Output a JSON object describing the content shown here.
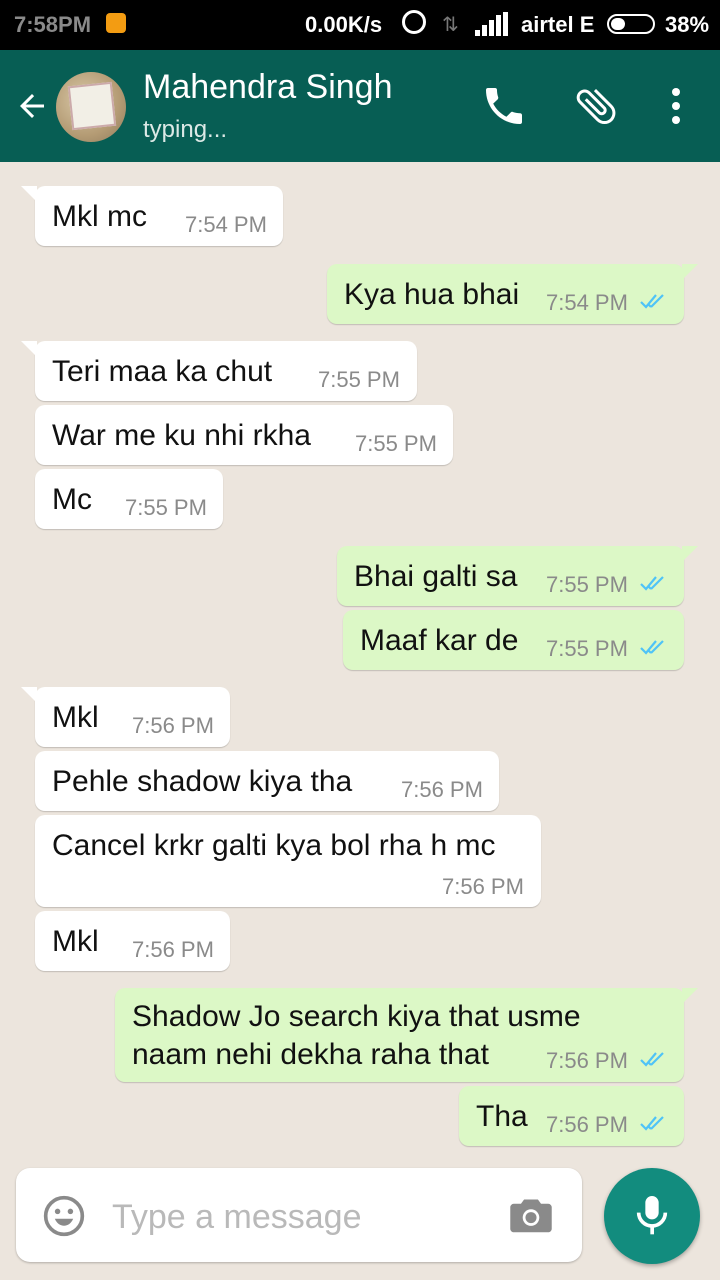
{
  "status_bar": {
    "time": "7:58PM",
    "speed": "0.00K/s",
    "carrier": "airtel E",
    "battery": "38%",
    "icons": [
      "notification-icon",
      "alarm-icon",
      "data-icon",
      "signal-icon",
      "battery-icon"
    ]
  },
  "header": {
    "name": "Mahendra Singh",
    "status": "typing...",
    "icons": [
      "back-arrow-icon",
      "phone-icon",
      "attach-icon",
      "more-icon"
    ]
  },
  "messages": [
    {
      "dir": "in",
      "text": "Mkl mc",
      "time": "7:54 PM"
    },
    {
      "dir": "out",
      "text": "Kya hua bhai",
      "time": "7:54 PM"
    },
    {
      "dir": "in",
      "text": "Teri maa ka chut",
      "time": "7:55 PM"
    },
    {
      "dir": "in",
      "text": "War me ku nhi rkha",
      "time": "7:55 PM"
    },
    {
      "dir": "in",
      "text": "Mc",
      "time": "7:55 PM"
    },
    {
      "dir": "out",
      "text": "Bhai galti sa",
      "time": "7:55 PM"
    },
    {
      "dir": "out",
      "text": "Maaf kar de",
      "time": "7:55 PM"
    },
    {
      "dir": "in",
      "text": "Mkl",
      "time": "7:56 PM"
    },
    {
      "dir": "in",
      "text": "Pehle shadow kiya tha",
      "time": "7:56 PM"
    },
    {
      "dir": "in",
      "text": "Cancel krkr galti kya bol rha h mc",
      "time": "7:56 PM"
    },
    {
      "dir": "in",
      "text": "Mkl",
      "time": "7:56 PM"
    },
    {
      "dir": "out",
      "text": "Shadow Jo search kiya that usme\nnaam nehi dekha raha that",
      "time": "7:56 PM"
    },
    {
      "dir": "out",
      "text": "Tha",
      "time": "7:56 PM"
    }
  ],
  "composer": {
    "placeholder": "Type a message"
  },
  "colors": {
    "header": "#075e54",
    "outgoing_bubble": "#dcf8c6",
    "incoming_bubble": "#ffffff",
    "read_ticks": "#4fc3f7",
    "mic_button": "#128c7e"
  }
}
